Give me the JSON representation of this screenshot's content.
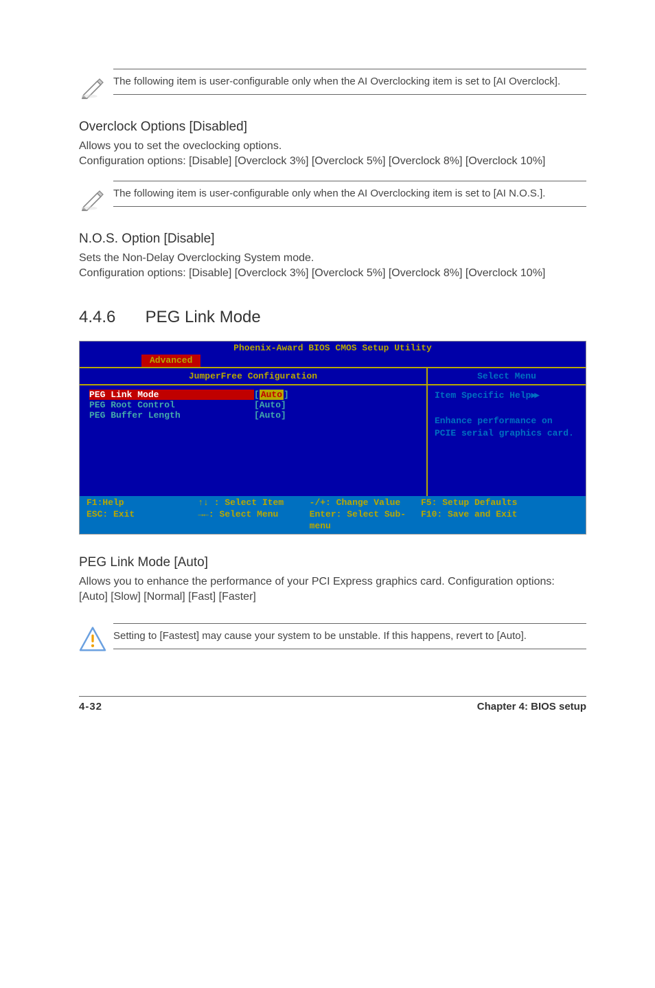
{
  "note1": "The following item is user-configurable only when the AI Overclocking item is set to [AI Overclock].",
  "overclock": {
    "heading": "Overclock Options [Disabled]",
    "body": "Allows you to set the oveclocking options.\nConfiguration options: [Disable] [Overclock 3%] [Overclock 5%] [Overclock 8%] [Overclock 10%]"
  },
  "note2": "The following item is user-configurable only when the AI Overclocking item is set to [AI N.O.S.].",
  "nos": {
    "heading": "N.O.S. Option [Disable]",
    "body": "Sets the Non-Delay Overclocking System mode.\nConfiguration options: [Disable] [Overclock 3%] [Overclock 5%] [Overclock 8%] [Overclock 10%]"
  },
  "section": {
    "num": "4.4.6",
    "title": "PEG Link Mode"
  },
  "bios": {
    "title": "Phoenix-Award BIOS CMOS Setup Utility",
    "active_tab": "Advanced",
    "left_header": "JumperFree Configuration",
    "right_header": "Select Menu",
    "items": [
      {
        "k": "PEG Link Mode",
        "v": "[Auto]"
      },
      {
        "k": "PEG Root Control",
        "v": "[Auto]"
      },
      {
        "k": "PEG Buffer Length",
        "v": "[Auto]"
      }
    ],
    "help_title": "Item Specific Help",
    "help_body": "Enhance performance on PCIE serial graphics card.",
    "footer": {
      "c1a": "F1:Help",
      "c1b": "ESC: Exit",
      "c2a": "↑↓ : Select Item",
      "c2b": "→←: Select Menu",
      "c3a": "-/+: Change Value",
      "c3b": "Enter: Select Sub-menu",
      "c4a": "F5: Setup Defaults",
      "c4b": "F10: Save and Exit"
    }
  },
  "peg": {
    "heading": "PEG Link Mode [Auto]",
    "body": "Allows you to enhance the performance of your PCI Express graphics card. Configuration options: [Auto] [Slow] [Normal] [Fast] [Faster]"
  },
  "warning": "Setting to [Fastest] may cause your system to be unstable. If this happens, revert to [Auto].",
  "footer": {
    "page": "4-32",
    "chapter": "Chapter 4: BIOS setup"
  }
}
